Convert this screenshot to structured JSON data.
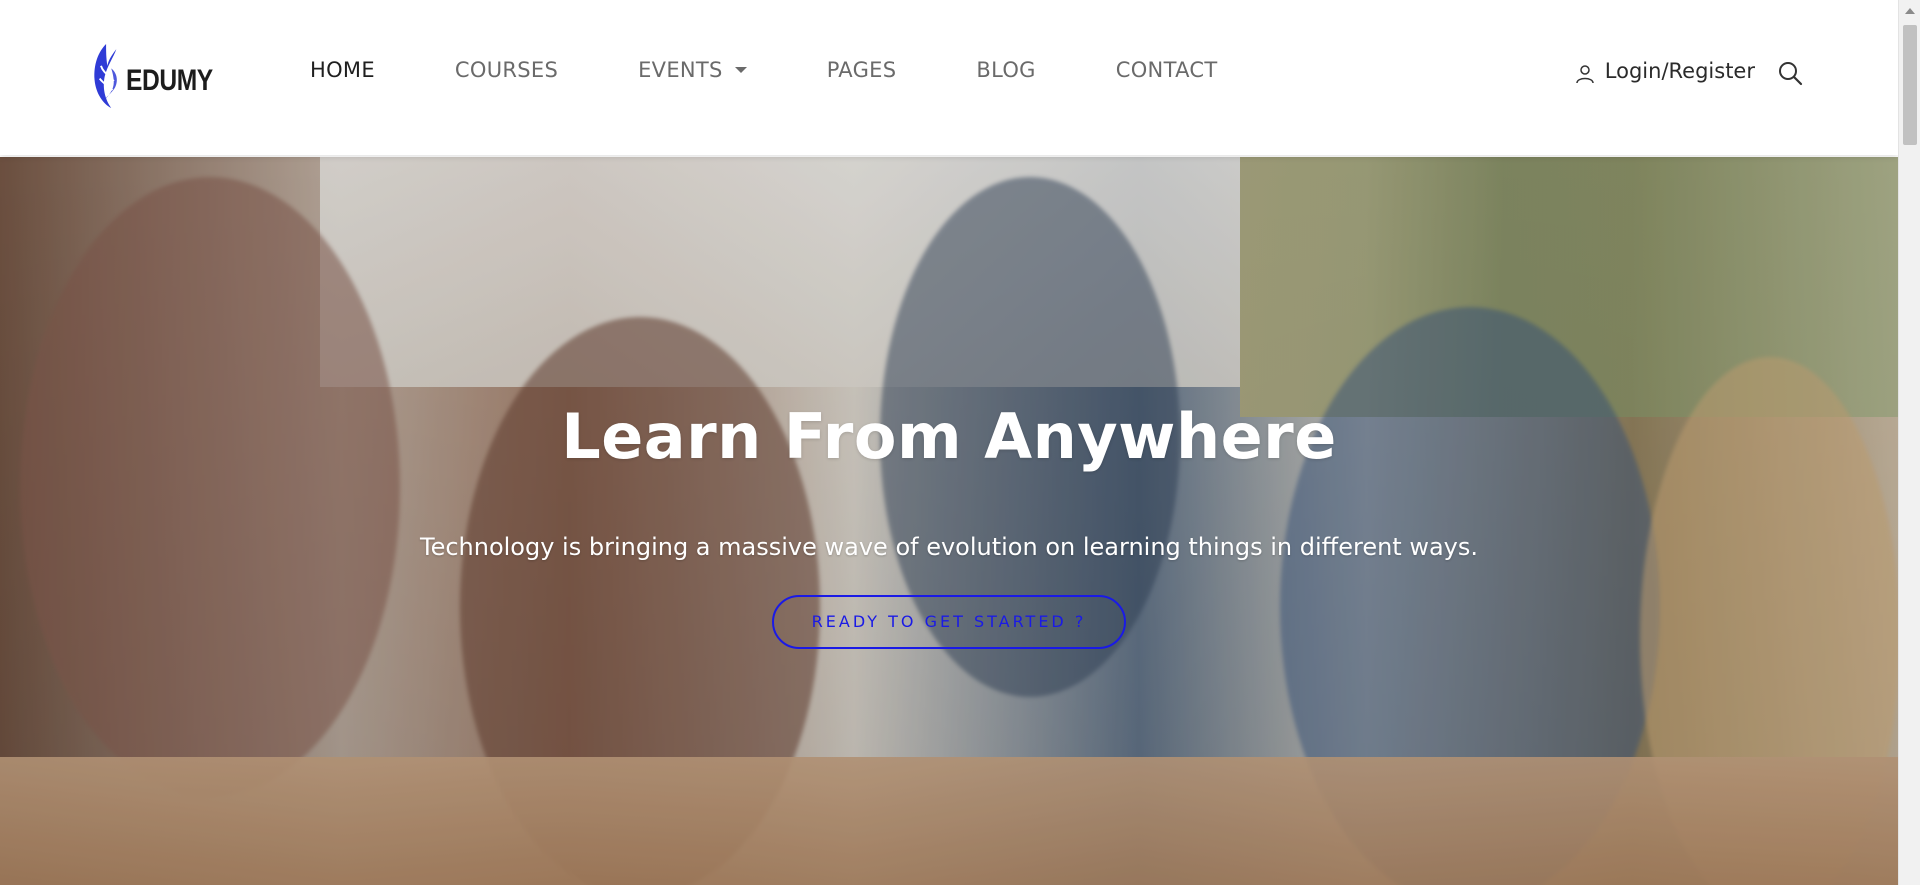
{
  "brand": {
    "name": "EDUMY",
    "logo_color": "#2f3bd6"
  },
  "nav": {
    "items": [
      {
        "label": "HOME",
        "active": true
      },
      {
        "label": "COURSES",
        "active": false
      },
      {
        "label": "EVENTS",
        "active": false,
        "has_dropdown": true
      },
      {
        "label": "PAGES",
        "active": false
      },
      {
        "label": "BLOG",
        "active": false
      },
      {
        "label": "CONTACT",
        "active": false
      }
    ]
  },
  "header": {
    "login_label": "Login/Register",
    "icons": [
      "user-icon",
      "search-icon"
    ]
  },
  "hero": {
    "title": "Learn From Anywhere",
    "subtitle": "Technology is bringing a massive wave of evolution on learning things in different ways.",
    "cta_label": "READY TO GET STARTED ?",
    "cta_color": "#1a1ae6"
  }
}
